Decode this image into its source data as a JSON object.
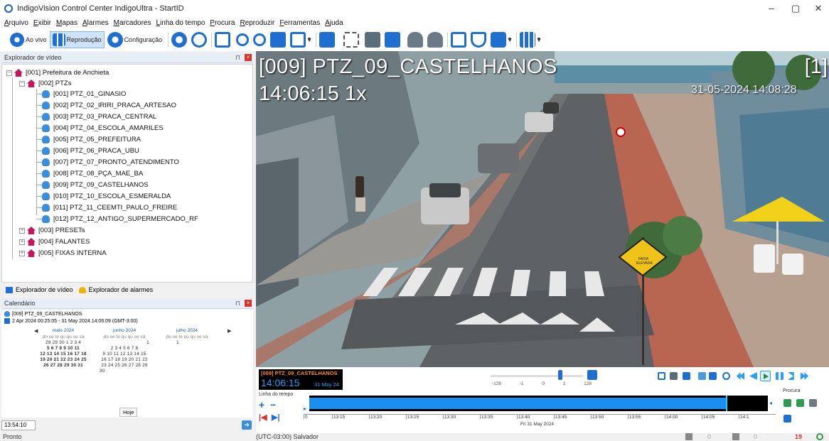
{
  "window": {
    "title": "IndigoVision Control Center IndigoUltra - StartID",
    "controls": [
      "–",
      "▢",
      "✕"
    ]
  },
  "menu": [
    "Arquivo",
    "Exibir",
    "Mapas",
    "Alarmes",
    "Marcadores",
    "Linha do tempo",
    "Procura",
    "Reproduzir",
    "Ferramentas",
    "Ajuda"
  ],
  "toolbar": {
    "live_label": "Ao vivo",
    "playback_label": "Reprodução",
    "config_label": "Configuração"
  },
  "video_explorer": {
    "title": "Explorador de vídeo",
    "pin": "⊓",
    "close": "×",
    "root": "[001] Prefeitura de Anchieta",
    "group_ptz": "[002] PTZs",
    "cameras": [
      "[001] PTZ_01_GINASIO",
      "[002] PTZ_02_IRIRI_PRACA_ARTESAO",
      "[003] PTZ_03_PRACA_CENTRAL",
      "[004] PTZ_04_ESCOLA_AMARILES",
      "[005] PTZ_05_PREFEITURA",
      "[006] PTZ_06_PRACA_UBU",
      "[007] PTZ_07_PRONTO_ATENDIMENTO",
      "[008] PTZ_08_PÇA_MAE_BA",
      "[009] PTZ_09_CASTELHANOS",
      "[010] PTZ_10_ESCOLA_ESMERALDA",
      "[011] PTZ_11_CEEMTI_PAULO_FREIRE",
      "[012] PTZ_12_ANTIGO_SUPERMERCADO_RF"
    ],
    "other_groups": [
      "[003] PRESETs",
      "[004] FALANTES",
      "[005] FIXAS INTERNA"
    ],
    "tabs": [
      "Explorador de vídeo",
      "Explorador de alarmes"
    ]
  },
  "calendar": {
    "title": "Calendário",
    "camera": "[009] PTZ_09_CASTELHANOS",
    "range": "2 Apr 2024 00:25:05 - 31 May 2024 14:06:09 (GMT-3:00)",
    "weekdays": "do se te qu qu se sá",
    "months": [
      {
        "name": "maio 2024",
        "rows": [
          "28 29 30  1  2  3  4",
          " 5  6  7  8  9 10 11",
          "12 13 14 15 16 17 18",
          "19 20 21 22 23 24 25",
          "26 27 28 29 30 31"
        ]
      },
      {
        "name": "junho 2024",
        "rows": [
          "                   1",
          " 2  3  4  5  6  7  8",
          " 9 10 11 12 13 14 15",
          "16 17 18 19 20 21 22",
          "23 24 25 26 27 28 29",
          "30"
        ]
      },
      {
        "name": "julho 2024",
        "rows": [
          " 1"
        ]
      }
    ],
    "today_label": "Hoje",
    "time_value": "13:54:10"
  },
  "video": {
    "camera_label": "[009] PTZ_09_CASTELHANOS",
    "time_speed": "14:06:15 1x",
    "index": "[1]",
    "cam_timestamp": "31-05-2024 14:08:28",
    "sign_text": "FAIXA ELEVADA"
  },
  "playback": {
    "mini_camera": "[009] PTZ_09_CASTELHANOS",
    "mini_time": "14:06:15",
    "mini_date": "31 May 24",
    "speed_scale": [
      "-128",
      "-1",
      "0",
      "1",
      "128"
    ],
    "timeline_label": "Linha do tempo",
    "ticks": [
      "0",
      "13:15",
      "13:20",
      "13:25",
      "13:30",
      "13:35",
      "13:40",
      "13:45",
      "13:50",
      "13:55",
      "14:00",
      "14:05",
      "14:1"
    ],
    "date_label": "Fri 31 May 2024",
    "search_label": "Procura"
  },
  "status": {
    "left": "Pronto",
    "timezone": "(UTC-03:00) Salvador",
    "count1": "0",
    "count2": "0",
    "alarms": "19"
  }
}
